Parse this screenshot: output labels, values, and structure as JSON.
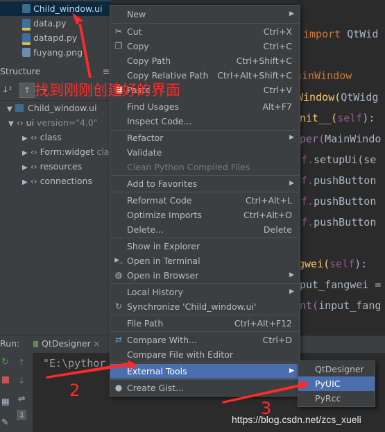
{
  "project_tree": {
    "files": [
      {
        "name": "Child_window.ui",
        "type": "ui",
        "selected": true
      },
      {
        "name": "data.py",
        "type": "py"
      },
      {
        "name": "datapd.py",
        "type": "py"
      },
      {
        "name": "fuyang.png",
        "type": "png"
      }
    ]
  },
  "structure": {
    "title": "Structure",
    "root": "Child_window.ui",
    "ui_label": "ui",
    "ui_attr": "version=\"4.0\"",
    "children": [
      "class",
      "Form:widget",
      "resources",
      "connections"
    ],
    "form_suffix": "cla"
  },
  "editor": {
    "lines": {
      "l1_kw": "import",
      "l1_rest": " QtWid",
      "l2": "ainWindow",
      "l3_a": "Window(",
      "l3_b": "QtWidg",
      "l4_a": "nit__(",
      "l4_self": "self",
      "l4_b": "):",
      "l5_a": "per(",
      "l5_b": "MainWindo",
      "l6_a": "f.",
      "l6_b": "setupUi(se",
      "l7_a": "f.",
      "l7_b": "pushButton",
      "l8_a": "f.",
      "l8_b": "pushButton",
      "l9_a": "f.",
      "l9_b": "pushButton",
      "l10_a": "gwei(",
      "l10_self": "self",
      "l10_b": "):",
      "l11": "put_fangwei =",
      "l12_a": "nt(",
      "l12_b": "input_fang"
    }
  },
  "context_menu": {
    "items": [
      {
        "label": "New",
        "submenu": true
      },
      {
        "label": "Cut",
        "shortcut": "Ctrl+X",
        "icon": "scissors-icon"
      },
      {
        "label": "Copy",
        "shortcut": "Ctrl+C",
        "icon": "copy-icon"
      },
      {
        "label": "Copy Path",
        "shortcut": "Ctrl+Shift+C"
      },
      {
        "label": "Copy Relative Path",
        "shortcut": "Ctrl+Alt+Shift+C"
      },
      {
        "label": "Paste",
        "shortcut": "Ctrl+V",
        "icon": "paste-icon"
      },
      {
        "label": "Find Usages",
        "shortcut": "Alt+F7"
      },
      {
        "label": "Inspect Code..."
      },
      {
        "label": "Refactor",
        "submenu": true
      },
      {
        "label": "Validate"
      },
      {
        "label": "Clean Python Compiled Files",
        "disabled": true
      },
      {
        "label": "Add to Favorites",
        "submenu": true
      },
      {
        "label": "Reformat Code",
        "shortcut": "Ctrl+Alt+L"
      },
      {
        "label": "Optimize Imports",
        "shortcut": "Ctrl+Alt+O"
      },
      {
        "label": "Delete...",
        "shortcut": "Delete"
      },
      {
        "label": "Show in Explorer"
      },
      {
        "label": "Open in Terminal",
        "icon": "terminal-icon"
      },
      {
        "label": "Open in Browser",
        "submenu": true,
        "icon": "globe-icon"
      },
      {
        "label": "Local History",
        "submenu": true
      },
      {
        "label": "Synchronize 'Child_window.ui'",
        "icon": "sync-icon"
      },
      {
        "label": "File Path",
        "shortcut": "Ctrl+Alt+F12"
      },
      {
        "label": "Compare With...",
        "shortcut": "Ctrl+D",
        "icon": "compare-icon"
      },
      {
        "label": "Compare File with Editor"
      },
      {
        "label": "External Tools",
        "submenu": true,
        "highlighted": true
      },
      {
        "label": "Create Gist...",
        "icon": "github-icon"
      }
    ]
  },
  "submenu": {
    "items": [
      {
        "label": "QtDesigner"
      },
      {
        "label": "PyUIC",
        "highlighted": true
      },
      {
        "label": "PyRcc"
      }
    ]
  },
  "run_panel": {
    "label": "Run:",
    "tab": "QtDesigner",
    "output_prefix": "\"E:\\pythor"
  },
  "annotations": {
    "main_text": "找到刚刚创建好的界面",
    "num2": "2",
    "num3": "3",
    "color": "#ff2a2a"
  },
  "watermark": "https://blog.csdn.net/zcs_xueli",
  "colors": {
    "menu_bg": "#3c3f41",
    "highlight": "#4b6eaf",
    "editor_bg": "#2b2b2b",
    "annotation": "#ff2a2a"
  }
}
